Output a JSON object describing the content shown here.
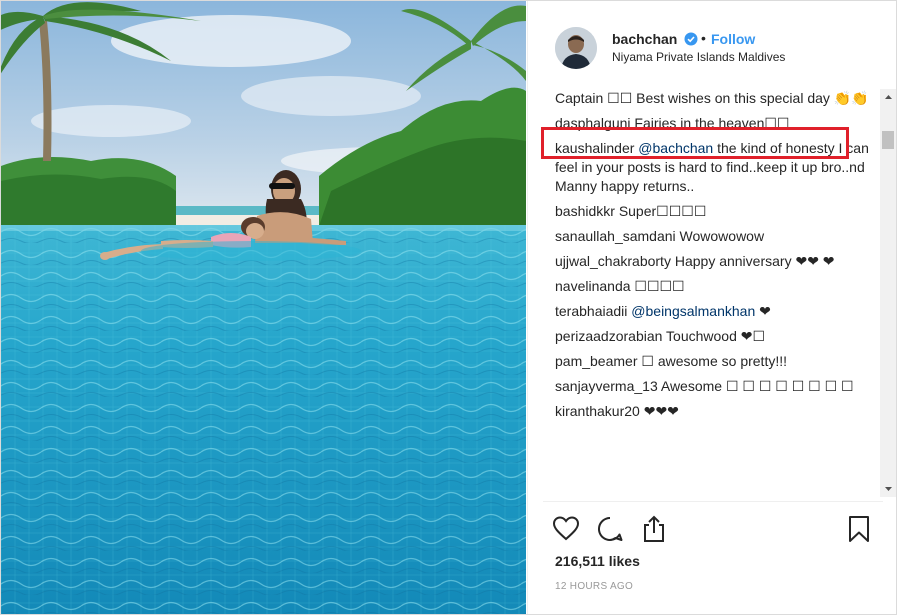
{
  "post": {
    "username": "bachchan",
    "separator": "•",
    "follow_label": "Follow",
    "location": "Niyama Private Islands Maldives"
  },
  "comments": [
    {
      "user": "",
      "text": "Captain ☐☐ Best wishes on this special day 👏👏",
      "mention": ""
    },
    {
      "user": "dasphalguni",
      "text": "Fairies in the heaven☐☐",
      "mention": ""
    },
    {
      "user": "kaushalinder",
      "mention": "@bachchan",
      "text": "the kind of honesty I can feel in your posts is hard to find..keep it up bro..nd Manny happy returns.."
    },
    {
      "user": "bashidkkr",
      "text": "Super☐☐☐☐",
      "mention": ""
    },
    {
      "user": "sanaullah_samdani",
      "text": "Wowowowow",
      "mention": ""
    },
    {
      "user": "ujjwal_chakraborty",
      "text": "Happy anniversary ❤❤ ❤",
      "mention": ""
    },
    {
      "user": "navelinanda",
      "text": "☐☐☐☐",
      "mention": ""
    },
    {
      "user": "terabhaiadii",
      "mention": "@beingsalmankhan",
      "text": "❤"
    },
    {
      "user": "perizaadzorabian",
      "text": "Touchwood ❤☐",
      "mention": ""
    },
    {
      "user": "pam_beamer",
      "text": "☐ awesome so pretty!!!",
      "mention": ""
    },
    {
      "user": "sanjayverma_13",
      "text": "Awesome ☐ ☐ ☐ ☐ ☐ ☐ ☐ ☐",
      "mention": ""
    },
    {
      "user": "kiranthakur20",
      "text": "❤❤❤",
      "mention": ""
    }
  ],
  "actions": {
    "like_icon": "heart-icon",
    "comment_icon": "comment-icon",
    "share_icon": "share-icon",
    "save_icon": "bookmark-icon"
  },
  "likes_text": "216,511 likes",
  "timestamp": "12 HOURS AGO",
  "colors": {
    "accent": "#3897f0",
    "highlight": "#e0202a",
    "text": "#262626",
    "muted": "#999999"
  }
}
